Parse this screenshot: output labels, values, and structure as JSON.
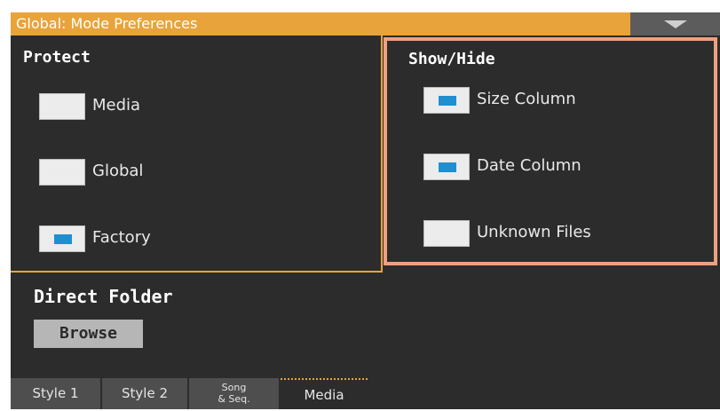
{
  "window": {
    "title": "Global: Mode Preferences"
  },
  "protect": {
    "title": "Protect",
    "items": [
      {
        "label": "Media",
        "checked": false
      },
      {
        "label": "Global",
        "checked": false
      },
      {
        "label": "Factory",
        "checked": true
      }
    ]
  },
  "showhide": {
    "title": "Show/Hide",
    "items": [
      {
        "label": "Size Column",
        "checked": true
      },
      {
        "label": "Date Column",
        "checked": true
      },
      {
        "label": "Unknown Files",
        "checked": false
      }
    ]
  },
  "direct_folder": {
    "title": "Direct Folder",
    "browse_label": "Browse"
  },
  "tabs": [
    {
      "label": "Style 1",
      "active": false
    },
    {
      "label": "Style 2",
      "active": false
    },
    {
      "label": "Song\n& Seq.",
      "active": false
    },
    {
      "label": "Media",
      "active": true
    }
  ],
  "colors": {
    "accent": "#e8a43a",
    "highlight_frame": "#f0a07e",
    "checkmark": "#1f8fd0",
    "background": "#2c2c2c"
  },
  "icons": {
    "menu": "triangle-down-icon"
  }
}
